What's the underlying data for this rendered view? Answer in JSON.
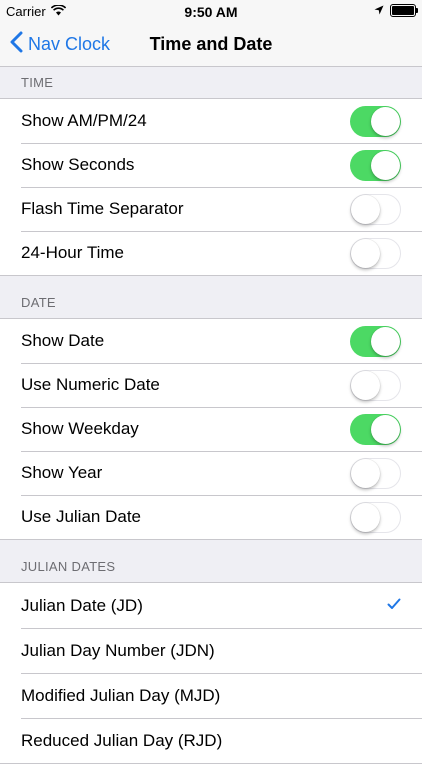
{
  "status_bar": {
    "carrier": "Carrier",
    "time": "9:50 AM",
    "wifi_icon": "wifi-icon",
    "location_icon": "location-arrow-icon",
    "battery_icon": "battery-icon"
  },
  "nav": {
    "back_label": "Nav Clock",
    "title": "Time and Date"
  },
  "sections": {
    "time": {
      "header": "TIME",
      "rows": [
        {
          "label": "Show AM/PM/24",
          "on": true
        },
        {
          "label": "Show Seconds",
          "on": true
        },
        {
          "label": "Flash Time Separator",
          "on": false
        },
        {
          "label": "24-Hour Time",
          "on": false
        }
      ]
    },
    "date": {
      "header": "DATE",
      "rows": [
        {
          "label": "Show Date",
          "on": true
        },
        {
          "label": "Use Numeric Date",
          "on": false
        },
        {
          "label": "Show Weekday",
          "on": true
        },
        {
          "label": "Show Year",
          "on": false
        },
        {
          "label": "Use Julian Date",
          "on": false
        }
      ]
    },
    "julian": {
      "header": "JULIAN DATES",
      "rows": [
        {
          "label": "Julian Date (JD)",
          "selected": true
        },
        {
          "label": "Julian Day Number (JDN)",
          "selected": false
        },
        {
          "label": "Modified Julian Day (MJD)",
          "selected": false
        },
        {
          "label": "Reduced Julian Day (RJD)",
          "selected": false
        }
      ]
    }
  },
  "colors": {
    "toggle_on": "#4cd964",
    "accent": "#1f77e6",
    "background": "#efeff4"
  }
}
